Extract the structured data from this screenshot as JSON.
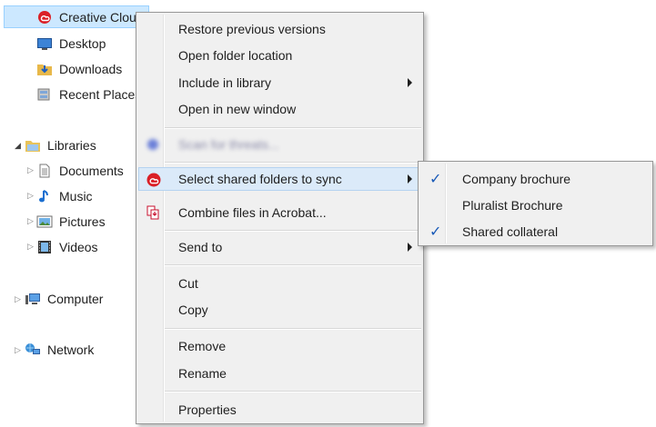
{
  "nav": {
    "favorites": [
      {
        "label": "Creative Cloud Files",
        "icon": "creative-cloud-icon",
        "selected": true
      },
      {
        "label": "Desktop",
        "icon": "desktop-icon"
      },
      {
        "label": "Downloads",
        "icon": "downloads-icon"
      },
      {
        "label": "Recent Places",
        "icon": "recent-places-icon"
      }
    ],
    "libraries": {
      "label": "Libraries",
      "items": [
        {
          "label": "Documents"
        },
        {
          "label": "Music"
        },
        {
          "label": "Pictures"
        },
        {
          "label": "Videos"
        }
      ]
    },
    "computer": "Computer",
    "network": "Network"
  },
  "context_menu": {
    "items": [
      {
        "label": "Restore previous versions"
      },
      {
        "label": "Open folder location"
      },
      {
        "label": "Include in library",
        "submenu": true
      },
      {
        "label": "Open in new window"
      },
      {
        "label": "Scan for threats...",
        "blurred": true
      },
      {
        "label": "Select shared folders to sync",
        "submenu": true,
        "highlighted": true,
        "icon": "creative-cloud-icon"
      },
      {
        "label": "Combine files in Acrobat...",
        "icon": "acrobat-combine-icon"
      },
      {
        "label": "Send to",
        "submenu": true
      },
      {
        "label": "Cut"
      },
      {
        "label": "Copy"
      },
      {
        "label": "Remove"
      },
      {
        "label": "Rename"
      },
      {
        "label": "Properties"
      }
    ]
  },
  "submenu": {
    "items": [
      {
        "label": "Company brochure",
        "checked": true
      },
      {
        "label": "Pluralist Brochure",
        "checked": false
      },
      {
        "label": "Shared collateral",
        "checked": true
      }
    ]
  },
  "colors": {
    "check": "#1a5bb8",
    "highlight": "#dbeaf9",
    "selection": "#cce8ff",
    "cc_red": "#da1f26"
  }
}
